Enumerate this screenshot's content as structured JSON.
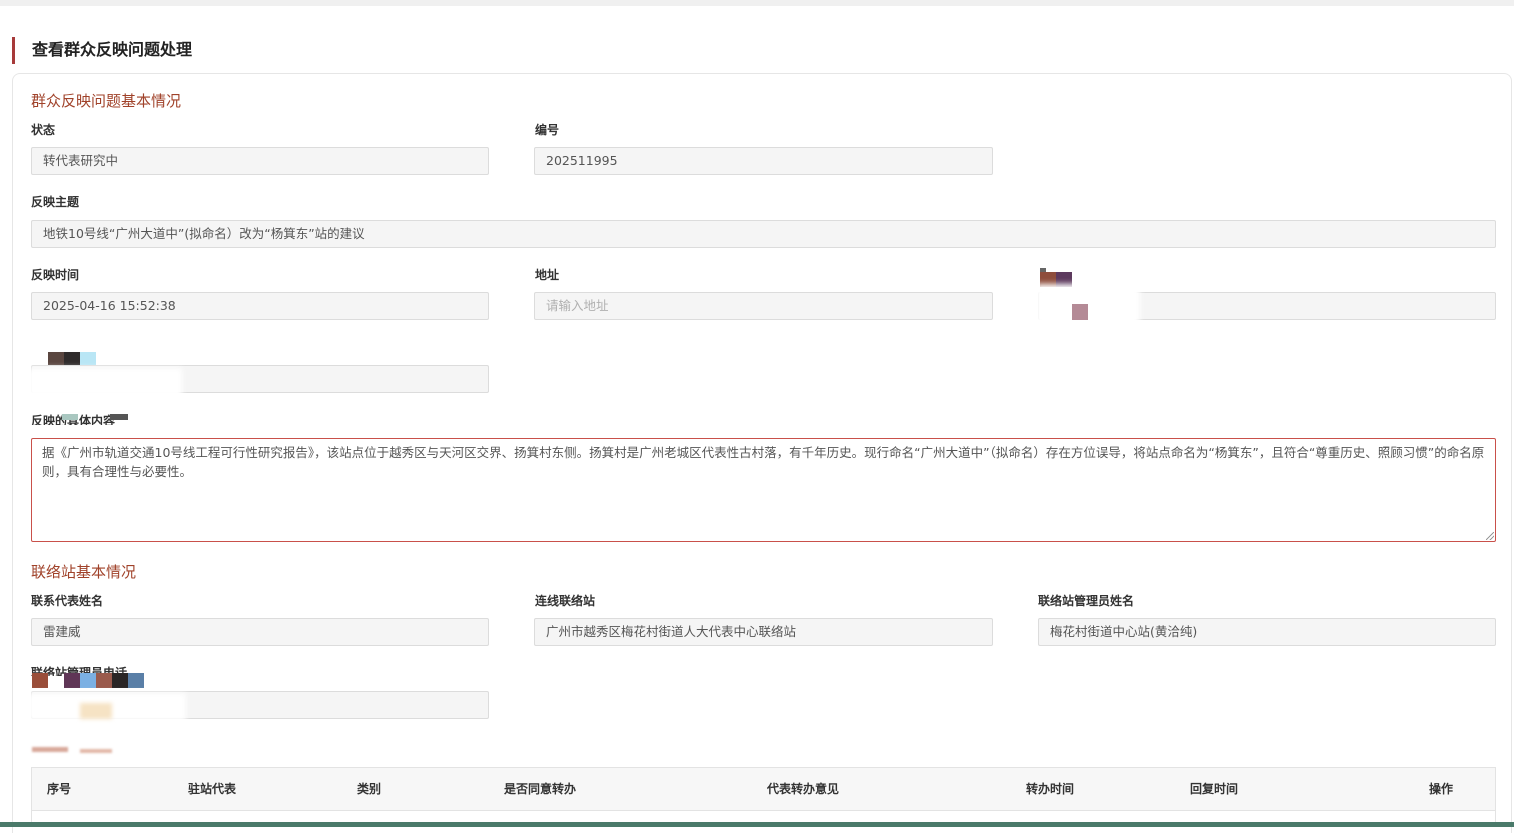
{
  "page": {
    "title": "查看群众反映问题处理"
  },
  "basic_section": {
    "title": "群众反映问题基本情况",
    "status_label": "状态",
    "status_value": "转代表研究中",
    "number_label": "编号",
    "number_value": "202511995",
    "subject_label": "反映主题",
    "subject_value": "地铁10号线“广州大道中”(拟命名）改为“杨箕东”站的建议",
    "time_label": "反映时间",
    "time_value": "2025-04-16 15:52:38",
    "address_label": "地址",
    "address_placeholder": "请输入地址",
    "content_label": "反映的具体内容",
    "content_value": "据《广州市轨道交通10号线工程可行性研究报告》，该站点位于越秀区与天河区交界、扬箕村东侧。扬箕村是广州老城区代表性古村落，有千年历史。现行命名“广州大道中”（拟命名）存在方位误导，将站点命名为“杨箕东”，且符合“尊重历史、照顾习惯”的命名原则，具有合理性与必要性。"
  },
  "station_section": {
    "title": "联络站基本情况",
    "rep_name_label": "联系代表姓名",
    "rep_name_value": "雷建威",
    "linked_station_label": "连线联络站",
    "linked_station_value": "广州市越秀区梅花村街道人大代表中心联络站",
    "manager_name_label": "联络站管理员姓名",
    "manager_name_value": "梅花村街道中心站(黄洽纯)",
    "manager_phone_label": "联络站管理员电话"
  },
  "table": {
    "columns": [
      "序号",
      "驻站代表",
      "类别",
      "是否同意转办",
      "代表转办意见",
      "转办时间",
      "回复时间",
      "操作"
    ]
  },
  "colors": {
    "accent": "#a73a3a",
    "section_title": "#a0422a",
    "textarea_border": "#c9504a"
  }
}
